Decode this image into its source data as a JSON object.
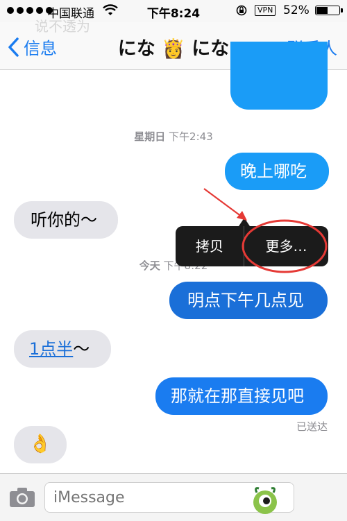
{
  "status": {
    "carrier": "中国联通",
    "time": "下午8:24",
    "vpn": "VPN",
    "battery": "52%",
    "battery_level": 0.52
  },
  "nav": {
    "back_label": "信息",
    "title": "にな 👸 にな",
    "contact_label": "联系人",
    "ghost_text": "说不透为"
  },
  "messages": {
    "ts1": {
      "day": "星期日",
      "time": "下午2:43"
    },
    "m1": "晚上哪吃",
    "m2": "听你的～",
    "ts2": {
      "day": "今天",
      "time": "下午8:22"
    },
    "m3": "明点下午几点见",
    "m4_link": "1点半",
    "m4_tail": "～",
    "m5": "那就在那直接见吧",
    "m6": "👌",
    "delivered": "已送达"
  },
  "context_menu": {
    "copy": "拷贝",
    "more": "更多…"
  },
  "input": {
    "placeholder": "iMessage"
  },
  "colors": {
    "ios_blue": "#1a7cf0",
    "bubble_out": "#1a9cf7",
    "bubble_out_dark": "#1a6fd8",
    "bubble_in": "#e5e5ea",
    "annotation_red": "#e53935"
  },
  "icons": [
    "wifi-icon",
    "lock-rotation-icon",
    "battery-icon",
    "back-chevron-icon",
    "camera-icon",
    "app-logo-icon"
  ]
}
